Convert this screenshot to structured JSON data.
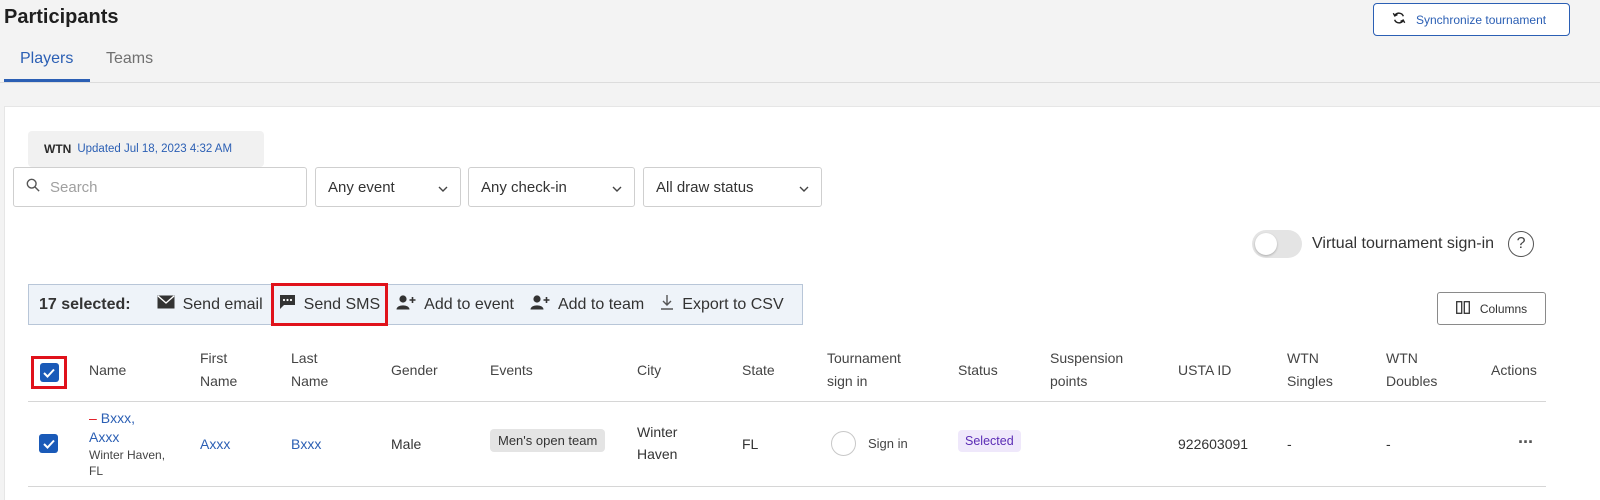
{
  "header": {
    "title": "Participants",
    "sync_label": "Synchronize tournament"
  },
  "tabs": [
    {
      "label": "Players",
      "active": true
    },
    {
      "label": "Teams",
      "active": false
    }
  ],
  "wtn": {
    "label": "WTN",
    "updated": "Updated Jul 18, 2023 4:32 AM"
  },
  "filters": {
    "search_placeholder": "Search",
    "event": "Any event",
    "checkin": "Any check-in",
    "draw_status": "All draw status"
  },
  "virtual_signin": {
    "label": "Virtual tournament sign-in",
    "enabled": false,
    "help": "?"
  },
  "bulk": {
    "count_label": "17 selected:",
    "actions": {
      "send_email": "Send email",
      "send_sms": "Send SMS",
      "add_to_event": "Add to event",
      "add_to_team": "Add to team",
      "export_csv": "Export to CSV"
    }
  },
  "columns_button": "Columns",
  "table": {
    "headers": {
      "name": "Name",
      "first_name_1": "First",
      "first_name_2": "Name",
      "last_name_1": "Last",
      "last_name_2": "Name",
      "gender": "Gender",
      "events": "Events",
      "city": "City",
      "state": "State",
      "signin_1": "Tournament",
      "signin_2": "sign in",
      "status": "Status",
      "suspension_1": "Suspension",
      "suspension_2": "points",
      "usta_id": "USTA ID",
      "wtn_singles_1": "WTN",
      "wtn_singles_2": "Singles",
      "wtn_doubles_1": "WTN",
      "wtn_doubles_2": "Doubles",
      "actions": "Actions"
    },
    "rows": [
      {
        "name_line1": "Bxxx,",
        "name_line2": "Axxx",
        "location_line1": "Winter Haven,",
        "location_line2": "FL",
        "first_name": "Axxx",
        "last_name": "Bxxx",
        "gender": "Male",
        "event": "Men's open team",
        "city_line1": "Winter",
        "city_line2": "Haven",
        "state": "FL",
        "signin_label": "Sign in",
        "status": "Selected",
        "suspension": "",
        "usta_id": "922603091",
        "wtn_singles": "-",
        "wtn_doubles": "-",
        "actions": "···"
      }
    ]
  },
  "colors": {
    "accent": "#2b5fb4",
    "highlight": "#e0121b",
    "status_selected_bg": "#efe8fb",
    "status_selected_text": "#5b2cb5"
  }
}
